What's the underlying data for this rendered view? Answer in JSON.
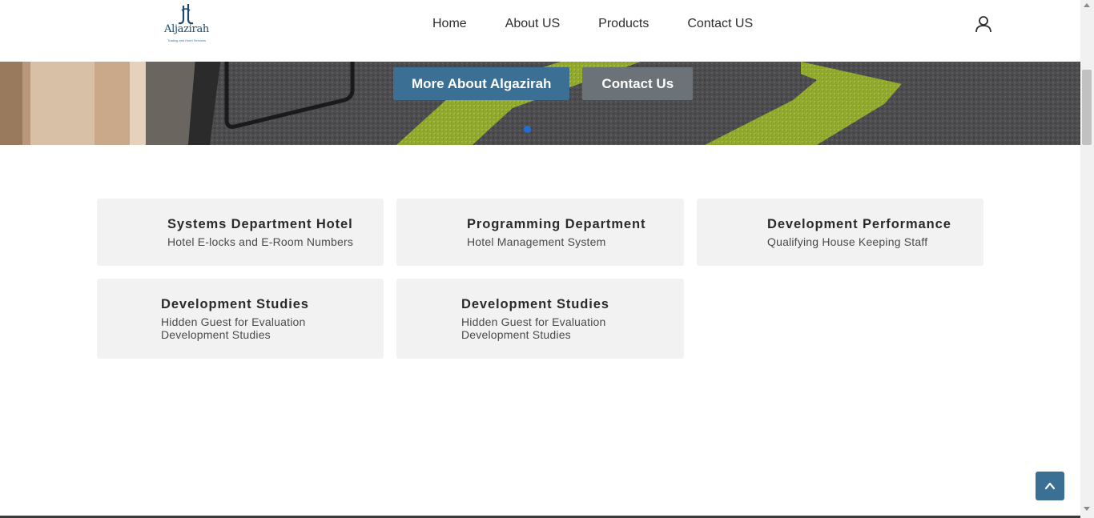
{
  "brand": {
    "logo_text": "Aljazirah",
    "logo_tagline": "Trading and Hotel Services"
  },
  "nav": {
    "links": [
      "Home",
      "About US",
      "Products",
      "Contact US"
    ]
  },
  "hero": {
    "primary_button": "More About Algazirah",
    "secondary_button": "Contact Us"
  },
  "cards": [
    {
      "title": "Systems Department Hotel",
      "lines": [
        "Hotel E-locks and E-Room Numbers"
      ]
    },
    {
      "title": "Programming Department",
      "lines": [
        "Hotel Management System"
      ]
    },
    {
      "title": "Development Performance",
      "lines": [
        "Qualifying House Keeping Staff"
      ]
    },
    {
      "title": "Development Studies",
      "lines": [
        "Hidden Guest for Evaluation",
        "Development Studies"
      ]
    },
    {
      "title": "Development Studies",
      "lines": [
        "Hidden Guest for Evaluation",
        "Development Studies"
      ]
    }
  ],
  "icons": {
    "user": "user-icon",
    "back_to_top": "chevron-up-icon"
  },
  "colors": {
    "primary": "#3b6f93",
    "secondary": "#6b7378",
    "card_bg": "#f2f2f2",
    "carpet_green": "#8fa82d"
  }
}
